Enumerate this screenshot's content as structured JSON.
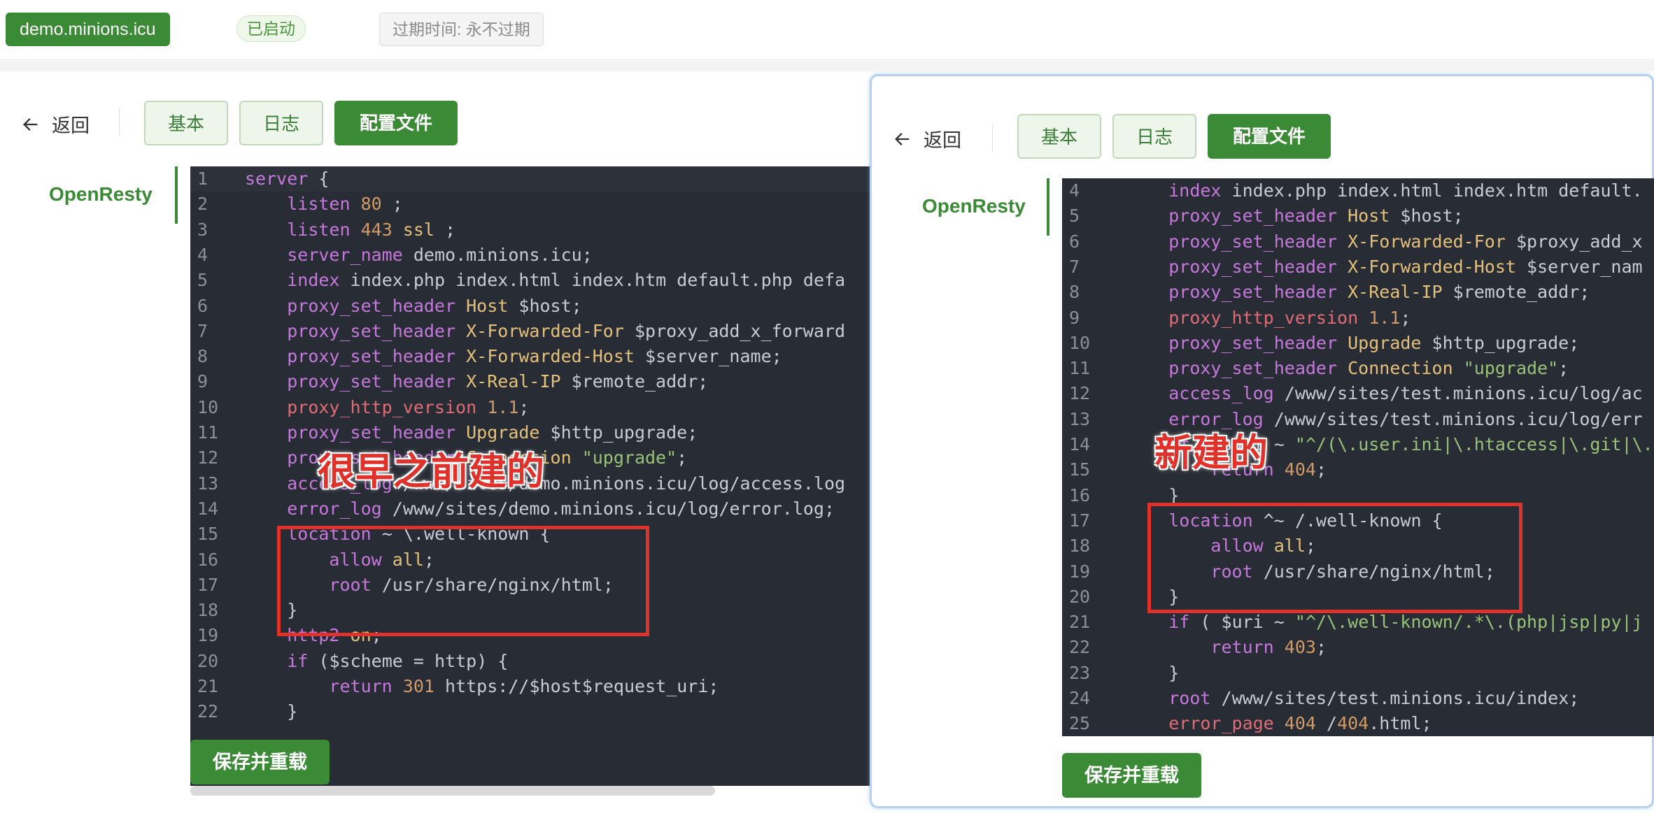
{
  "header": {
    "domain": "demo.minions.icu",
    "status": "已启动",
    "expire": "过期时间: 永不过期"
  },
  "left": {
    "back_label": "返回",
    "tabs": [
      "基本",
      "日志",
      "配置文件"
    ],
    "active_tab": "配置文件",
    "side_label": "OpenResty",
    "save_label": "保存并重载",
    "annotation": "很早之前建的",
    "lines": [
      {
        "n": "1",
        "code": "server {"
      },
      {
        "n": "2",
        "code": "    listen 80 ;"
      },
      {
        "n": "3",
        "code": "    listen 443 ssl ;"
      },
      {
        "n": "4",
        "code": "    server_name demo.minions.icu;"
      },
      {
        "n": "5",
        "code": "    index index.php index.html index.htm default.php defa"
      },
      {
        "n": "6",
        "code": "    proxy_set_header Host $host;"
      },
      {
        "n": "7",
        "code": "    proxy_set_header X-Forwarded-For $proxy_add_x_forward"
      },
      {
        "n": "8",
        "code": "    proxy_set_header X-Forwarded-Host $server_name;"
      },
      {
        "n": "9",
        "code": "    proxy_set_header X-Real-IP $remote_addr;"
      },
      {
        "n": "10",
        "code": "    proxy_http_version 1.1;"
      },
      {
        "n": "11",
        "code": "    proxy_set_header Upgrade $http_upgrade;"
      },
      {
        "n": "12",
        "code": "    proxy_set_header Connection \"upgrade\";"
      },
      {
        "n": "13",
        "code": "    access_log /www/sites/demo.minions.icu/log/access.log"
      },
      {
        "n": "14",
        "code": "    error_log /www/sites/demo.minions.icu/log/error.log;"
      },
      {
        "n": "15",
        "code": "    location ~ \\.well-known {"
      },
      {
        "n": "16",
        "code": "        allow all;"
      },
      {
        "n": "17",
        "code": "        root /usr/share/nginx/html;"
      },
      {
        "n": "18",
        "code": "    }"
      },
      {
        "n": "19",
        "code": "    http2 on;"
      },
      {
        "n": "20",
        "code": "    if ($scheme = http) {"
      },
      {
        "n": "21",
        "code": "        return 301 https://$host$request_uri;"
      },
      {
        "n": "22",
        "code": "    }"
      }
    ]
  },
  "right": {
    "back_label": "返回",
    "tabs": [
      "基本",
      "日志",
      "配置文件"
    ],
    "active_tab": "配置文件",
    "side_label": "OpenResty",
    "save_label": "保存并重载",
    "annotation": "新建的",
    "lines": [
      {
        "n": "4",
        "code": "    index index.php index.html index.htm default."
      },
      {
        "n": "5",
        "code": "    proxy_set_header Host $host;"
      },
      {
        "n": "6",
        "code": "    proxy_set_header X-Forwarded-For $proxy_add_x"
      },
      {
        "n": "7",
        "code": "    proxy_set_header X-Forwarded-Host $server_nam"
      },
      {
        "n": "8",
        "code": "    proxy_set_header X-Real-IP $remote_addr;"
      },
      {
        "n": "9",
        "code": "    proxy_http_version 1.1;"
      },
      {
        "n": "10",
        "code": "    proxy_set_header Upgrade $http_upgrade;"
      },
      {
        "n": "11",
        "code": "    proxy_set_header Connection \"upgrade\";"
      },
      {
        "n": "12",
        "code": "    access_log /www/sites/test.minions.icu/log/ac"
      },
      {
        "n": "13",
        "code": "    error_log /www/sites/test.minions.icu/log/err"
      },
      {
        "n": "14",
        "code": "    if ( $uri ~ \"^/(\\.user.ini|\\.htaccess|\\.git|\\.e"
      },
      {
        "n": "15",
        "code": "        return 404;"
      },
      {
        "n": "16",
        "code": "    }"
      },
      {
        "n": "17",
        "code": "    location ^~ /.well-known {"
      },
      {
        "n": "18",
        "code": "        allow all;"
      },
      {
        "n": "19",
        "code": "        root /usr/share/nginx/html;"
      },
      {
        "n": "20",
        "code": "    }"
      },
      {
        "n": "21",
        "code": "    if ( $uri ~ \"^/\\.well-known/.*\\.(php|jsp|py|j"
      },
      {
        "n": "22",
        "code": "        return 403;"
      },
      {
        "n": "23",
        "code": "    }"
      },
      {
        "n": "24",
        "code": "    root /www/sites/test.minions.icu/index;"
      },
      {
        "n": "25",
        "code": "    error_page 404 /404.html;"
      }
    ]
  },
  "colors": {
    "brand_green": "#3b8a36",
    "editor_bg": "#282c34",
    "annotation_red": "#e0312b",
    "keyword": "#c678dd",
    "header_name": "#e5c07b",
    "number": "#d19a66",
    "string": "#98c379"
  },
  "icons": {
    "back": "arrow-left-icon"
  }
}
